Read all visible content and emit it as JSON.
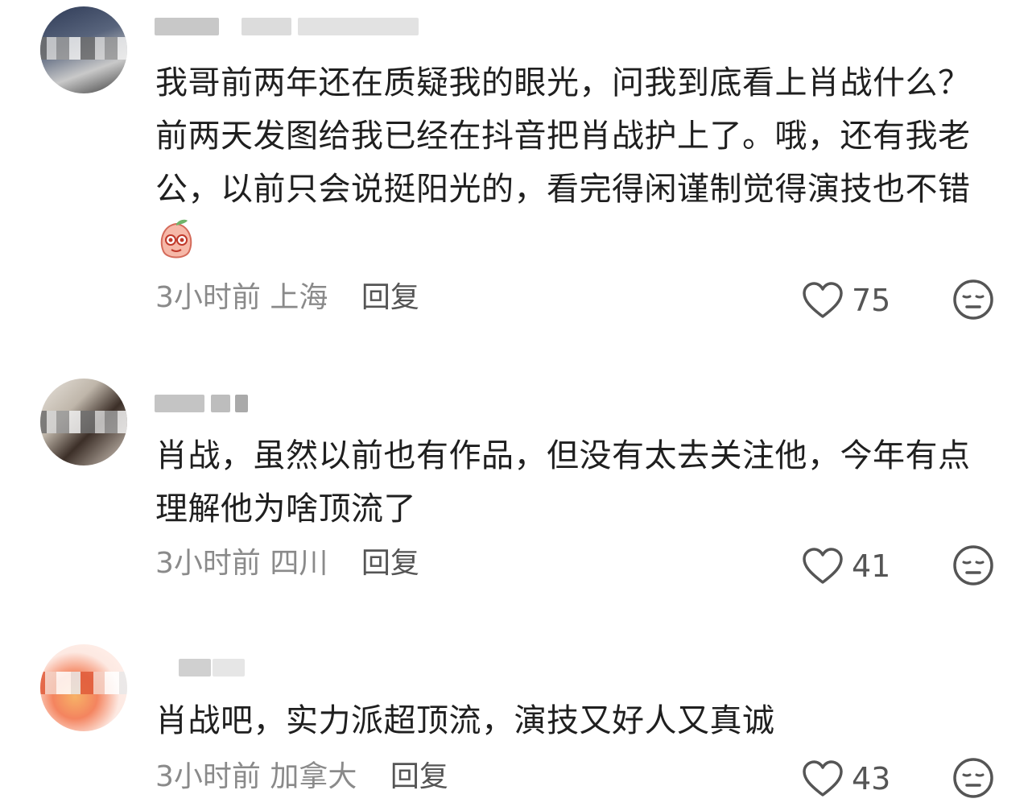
{
  "comments": [
    {
      "text_lines": [
        "我哥前两年还在质疑我的眼光，问我到底看上肖战什么？",
        "前两天发图给我已经在抖音把肖战护上了。哦，还有我老",
        "公，以前只会说挺阳光的，看完得闲谨制觉得演技也不错"
      ],
      "sticker": "peach-face-sticker-icon",
      "time": "3小时前",
      "location": "上海",
      "reply_label": "回复",
      "likes": "75"
    },
    {
      "text_lines": [
        "肖战，虽然以前也有作品，但没有太去关注他，今年有点",
        "理解他为啥顶流了"
      ],
      "time": "3小时前",
      "location": "四川",
      "reply_label": "回复",
      "likes": "41"
    },
    {
      "text_lines": [
        "肖战吧，实力派超顶流，演技又好人又真诚"
      ],
      "time": "3小时前",
      "location": "加拿大",
      "reply_label": "回复",
      "likes": "43"
    }
  ],
  "icons": {
    "like": "heart-outline-icon",
    "dislike": "neutral-face-icon"
  },
  "colors": {
    "text": "#1f1f1f",
    "meta": "#8a8a8a",
    "icon": "#555555"
  }
}
